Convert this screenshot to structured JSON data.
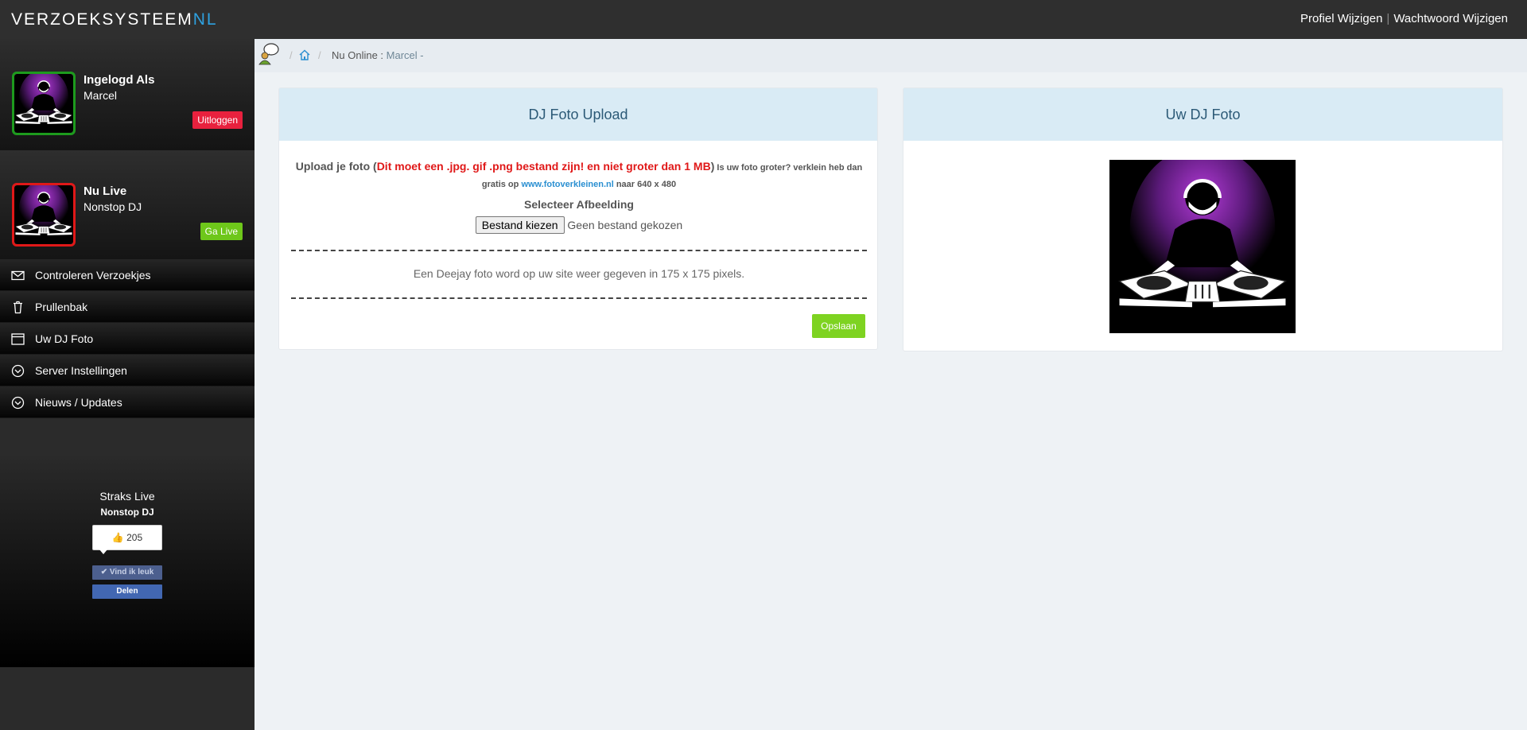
{
  "topbar": {
    "brand_main": "VERZOEKSYSTEEM",
    "brand_accent": "NL",
    "links": [
      "Profiel Wijzigen",
      "Wachtwoord Wijzigen"
    ],
    "separator": "|"
  },
  "sidebar": {
    "logged_in": {
      "title": "Ingelogd Als",
      "name": "Marcel",
      "button": "Uitloggen"
    },
    "now_live": {
      "title": "Nu Live",
      "name": "Nonstop DJ",
      "button": "Ga Live"
    },
    "menu": [
      {
        "label": "Controleren Verzoekjes",
        "icon": "envelope-icon"
      },
      {
        "label": "Prullenbak",
        "icon": "trash-icon"
      },
      {
        "label": "Uw DJ Foto",
        "icon": "window-icon"
      },
      {
        "label": "Server Instellingen",
        "icon": "circle-chevron-icon"
      },
      {
        "label": "Nieuws / Updates",
        "icon": "circle-chevron-icon"
      }
    ],
    "upcoming": {
      "title": "Straks Live",
      "name": "Nonstop DJ",
      "like_count": "205",
      "like_label": "Vind ik leuk",
      "share_label": "Delen"
    }
  },
  "breadcrumb": {
    "separator": "/",
    "label": "Nu Online : ",
    "name": "Marcel -"
  },
  "upload_panel": {
    "title": "DJ Foto Upload",
    "intro": "Upload je foto (",
    "warning": "Dit moet een .jpg. gif .png bestand zijn! en niet groter dan 1 MB",
    "close_paren": ")",
    "hint_before": " Is uw foto groter? verklein heb dan gratis op ",
    "hint_link": "www.fotoverkleinen.nl",
    "hint_after": " naar 640 x 480",
    "select_label": "Selecteer Afbeelding",
    "file_button": "Bestand kiezen",
    "file_status": "Geen bestand gekozen",
    "info": "Een Deejay foto word op uw site weer gegeven in 175 x 175 pixels.",
    "save_button": "Opslaan"
  },
  "photo_panel": {
    "title": "Uw DJ Foto"
  },
  "colors": {
    "accent": "#2ea1e0",
    "danger": "#e8213e",
    "success": "#6ec71a",
    "panel_head": "#d9ebf5"
  }
}
